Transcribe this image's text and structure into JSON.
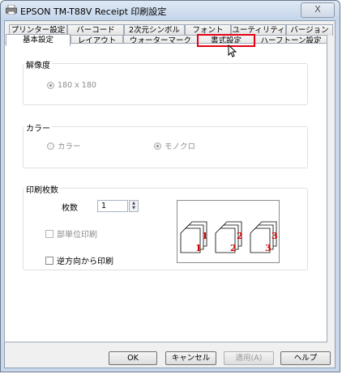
{
  "window": {
    "title": "EPSON TM-T88V Receipt 印刷設定",
    "close_label": "X"
  },
  "tabs_top": [
    {
      "label": "プリンター設定"
    },
    {
      "label": "バーコード"
    },
    {
      "label": "2次元シンボル"
    },
    {
      "label": "フォント"
    },
    {
      "label": "ユーティリティ"
    },
    {
      "label": "バージョン"
    }
  ],
  "tabs_bottom": [
    {
      "label": "基本設定",
      "active": true
    },
    {
      "label": "レイアウト"
    },
    {
      "label": "ウォーターマーク"
    },
    {
      "label": "書式設定",
      "highlighted": true
    },
    {
      "label": "ハーフトーン設定"
    }
  ],
  "resolution": {
    "title": "解像度",
    "option": "180 x 180"
  },
  "color": {
    "title": "カラー",
    "options": [
      "カラー",
      "モノクロ"
    ],
    "selected": "モノクロ"
  },
  "copies": {
    "title": "印刷枚数",
    "count_label": "枚数",
    "count_value": "1",
    "collate_label": "部単位印刷",
    "collate_checked": false,
    "reverse_label": "逆方向から印刷",
    "reverse_checked": false,
    "preview_numbers": [
      "1",
      "2",
      "3"
    ]
  },
  "buttons": {
    "ok": "OK",
    "cancel": "キャンセル",
    "apply": "適用(A)",
    "help": "ヘルプ"
  },
  "colors": {
    "highlight": "#e60012",
    "page_number": "#cc0000"
  }
}
